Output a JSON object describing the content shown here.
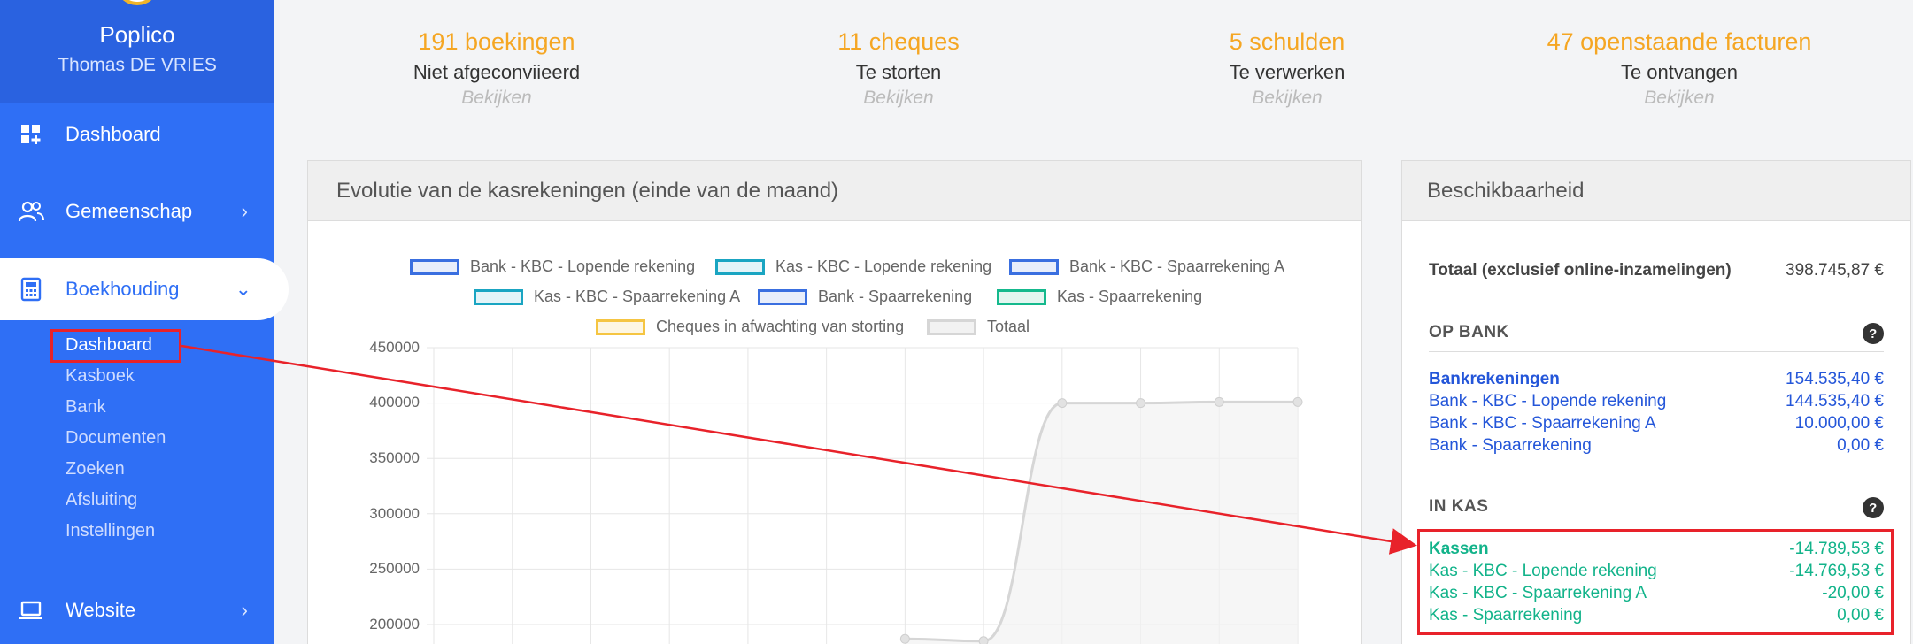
{
  "sidebar": {
    "org": "Poplico",
    "user": "Thomas DE VRIES",
    "nav": [
      {
        "label": "Dashboard"
      },
      {
        "label": "Gemeenschap"
      },
      {
        "label": "Boekhouding"
      },
      {
        "label": "Website"
      }
    ],
    "sub": [
      "Dashboard",
      "Kasboek",
      "Bank",
      "Documenten",
      "Zoeken",
      "Afsluiting",
      "Instellingen"
    ]
  },
  "stats": [
    {
      "big": "191 boekingen",
      "mid": "Niet afgeconviieerd",
      "link": "Bekijken"
    },
    {
      "big": "11 cheques",
      "mid": "Te storten",
      "link": "Bekijken"
    },
    {
      "big": "5 schulden",
      "mid": "Te verwerken",
      "link": "Bekijken"
    },
    {
      "big": "47 openstaande facturen",
      "mid": "Te ontvangen",
      "link": "Bekijken"
    }
  ],
  "chart_card": {
    "title": "Evolutie van de kasrekeningen (einde van de maand)"
  },
  "chart_data": {
    "type": "line",
    "title": "",
    "xlabel": "",
    "ylabel": "",
    "ylim": [
      200000,
      450000
    ],
    "yticks": [
      "450000",
      "400000",
      "350000",
      "300000",
      "250000",
      "200000"
    ],
    "grid": true,
    "legend_placement": "top",
    "x": [
      1,
      2,
      3,
      4,
      5,
      6,
      7,
      8,
      9,
      10,
      11,
      12
    ],
    "series": [
      {
        "name": "Bank - KBC - Lopende rekening",
        "color": "#3a6fe0",
        "values": []
      },
      {
        "name": "Kas - KBC - Lopende rekening",
        "color": "#1aa5c2",
        "values": []
      },
      {
        "name": "Bank - KBC - Spaarrekening A",
        "color": "#3a6fe0",
        "values": []
      },
      {
        "name": "Kas - KBC - Spaarrekening A",
        "color": "#1aa5c2",
        "values": []
      },
      {
        "name": "Bank - Spaarrekening",
        "color": "#3a6fe0",
        "values": []
      },
      {
        "name": "Kas - Spaarrekening",
        "color": "#15b98d",
        "values": []
      },
      {
        "name": "Cheques in afwachting van storting",
        "color": "#f5c542",
        "values": []
      },
      {
        "name": "Totaal",
        "color": "#d6d6d6",
        "values": [
          null,
          null,
          null,
          null,
          null,
          null,
          187000,
          185000,
          400000,
          400000,
          401000,
          401000
        ]
      }
    ]
  },
  "right_card": {
    "title": "Beschikbaarheid",
    "total_label": "Totaal (exclusief online-inzamelingen)",
    "total_value": "398.745,87 €",
    "bank_title": "OP BANK",
    "bank_rows": [
      {
        "label": "Bankrekeningen",
        "value": "154.535,40 €",
        "bold": true
      },
      {
        "label": "Bank - KBC - Lopende rekening",
        "value": "144.535,40 €"
      },
      {
        "label": "Bank - KBC - Spaarrekening A",
        "value": "10.000,00 €"
      },
      {
        "label": "Bank - Spaarrekening",
        "value": "0,00 €"
      }
    ],
    "kas_title": "IN KAS",
    "kas_rows": [
      {
        "label": "Kassen",
        "value": "-14.789,53 €",
        "bold": true
      },
      {
        "label": "Kas - KBC - Lopende rekening",
        "value": "-14.769,53 €"
      },
      {
        "label": "Kas - KBC - Spaarrekening A",
        "value": "-20,00 €"
      },
      {
        "label": "Kas - Spaarrekening",
        "value": "0,00 €"
      }
    ],
    "help_glyph": "?"
  },
  "colors": {
    "sidebar": "#2f6ff5",
    "accent": "#f5a623",
    "highlight": "#e8222a"
  }
}
